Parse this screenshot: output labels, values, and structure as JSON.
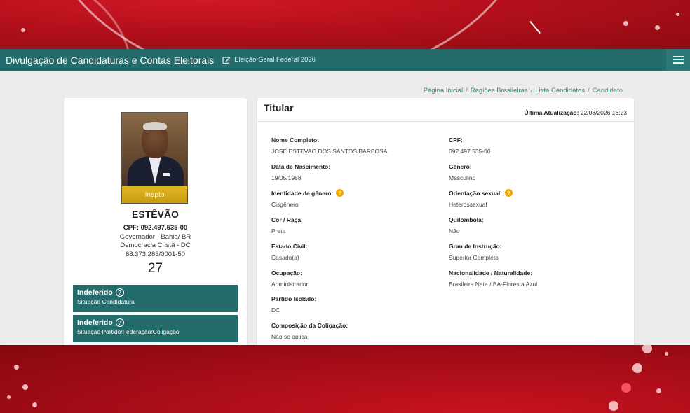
{
  "colors": {
    "brand_teal": "#246b6b",
    "background_red": "#b5101c",
    "status_yellow": "#e0b820",
    "link_green": "#2a8a78"
  },
  "navbar": {
    "title": "Divulgação de Candidaturas e Contas Eleitorais",
    "election": "Eleição Geral Federal 2026",
    "election_icon": "pencil-square-icon",
    "menu_icon": "hamburger-icon"
  },
  "breadcrumb": [
    "Página Inicial",
    "Regiões Brasileiras",
    "Lista Candidatos",
    "Candidato"
  ],
  "candidate": {
    "photo_status": "Inapto",
    "name": "ESTÊVÃO",
    "cpf_line": "CPF: 092.497.535-00",
    "office": "Governador - Bahia/ BR",
    "party": "Democracia Cristã - DC",
    "cnpj": "68.373.283/0001-50",
    "number": "27",
    "status": [
      {
        "title": "Indeferido",
        "subtitle": "Situação Candidatura"
      },
      {
        "title": "Indeferido",
        "subtitle": "Situação Partido/Federação/Coligação"
      }
    ]
  },
  "details": {
    "title": "Titular",
    "updated_label": "Última Atualização:",
    "updated_value": "22/08/2026 16:23",
    "left_fields": [
      {
        "label": "Nome Completo:",
        "value": "JOSE ESTEVAO DOS SANTOS BARBOSA"
      },
      {
        "label": "Data de Nascimento:",
        "value": "19/05/1958"
      },
      {
        "label": "Identidade de gênero:",
        "value": "Cisgênero",
        "info": "?"
      },
      {
        "label": "Cor / Raça:",
        "value": "Preta"
      },
      {
        "label": "Estado Civil:",
        "value": "Casado(a)"
      },
      {
        "label": "Ocupação:",
        "value": "Administrador"
      },
      {
        "label": "Partido Isolado:",
        "value": "DC"
      },
      {
        "label": "Composição da Coligação:",
        "value": "Não se aplica"
      }
    ],
    "right_fields": [
      {
        "label": "CPF:",
        "value": "092.497.535-00"
      },
      {
        "label": "Gênero:",
        "value": "Masculino"
      },
      {
        "label": "Orientação sexual:",
        "value": "Heterossexual",
        "info": "?"
      },
      {
        "label": "Quilombola:",
        "value": "Não"
      },
      {
        "label": "Grau de Instrução:",
        "value": "Superior Completo"
      },
      {
        "label": "Nacionalidade / Naturalidade:",
        "value": "Brasileira Nata / BA-Floresta Azul"
      }
    ]
  }
}
